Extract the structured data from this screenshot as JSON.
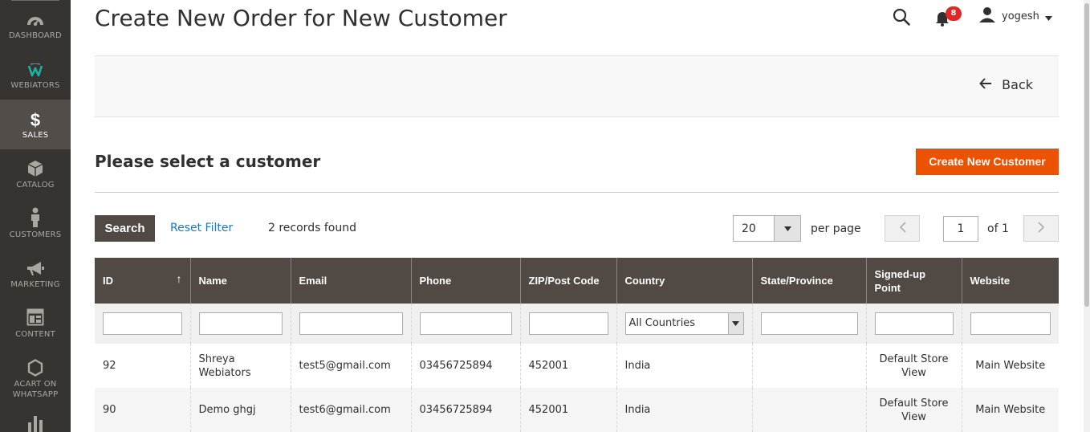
{
  "header": {
    "title": "Create New Order for New Customer",
    "notifications_count": "8",
    "user_name": "yogesh"
  },
  "sidebar": {
    "items": [
      {
        "label": "DASHBOARD",
        "icon": "dashboard-gauge-icon"
      },
      {
        "label": "WEBIATORS",
        "icon": "webiators-logo-icon"
      },
      {
        "label": "SALES",
        "icon": "dollar-icon",
        "active": true
      },
      {
        "label": "CATALOG",
        "icon": "box-icon"
      },
      {
        "label": "CUSTOMERS",
        "icon": "person-icon"
      },
      {
        "label": "MARKETING",
        "icon": "megaphone-icon"
      },
      {
        "label": "CONTENT",
        "icon": "layout-icon"
      },
      {
        "label": "ACART ON WHATSAPP",
        "icon": "hexagon-icon"
      },
      {
        "label": "",
        "icon": "bar-chart-icon"
      }
    ]
  },
  "action_bar": {
    "back_label": "Back"
  },
  "section": {
    "title": "Please select a customer",
    "create_button": "Create New Customer"
  },
  "toolbar": {
    "search_label": "Search",
    "reset_label": "Reset Filter",
    "records_found": "2 records found",
    "per_page_value": "20",
    "per_page_label": "per page",
    "current_page": "1",
    "of_pages": "of 1"
  },
  "grid": {
    "columns": [
      "ID",
      "Name",
      "Email",
      "Phone",
      "ZIP/Post Code",
      "Country",
      "State/Province",
      "Signed-up Point",
      "Website"
    ],
    "country_filter": "All Countries",
    "rows": [
      {
        "id": "92",
        "name": "Shreya Webiators",
        "email": "test5@gmail.com",
        "phone": "03456725894",
        "zip": "452001",
        "country": "India",
        "state": "",
        "signup": "Default Store View",
        "website": "Main Website"
      },
      {
        "id": "90",
        "name": "Demo ghgj",
        "email": "test6@gmail.com",
        "phone": "03456725894",
        "zip": "452001",
        "country": "India",
        "state": "",
        "signup": "Default Store View",
        "website": "Main Website"
      }
    ]
  },
  "colors": {
    "sidebar_bg": "#373330",
    "sidebar_active": "#524d49",
    "accent_orange": "#eb5202",
    "grid_header": "#514943",
    "link_blue": "#1979c3",
    "badge_red": "#e22626"
  }
}
